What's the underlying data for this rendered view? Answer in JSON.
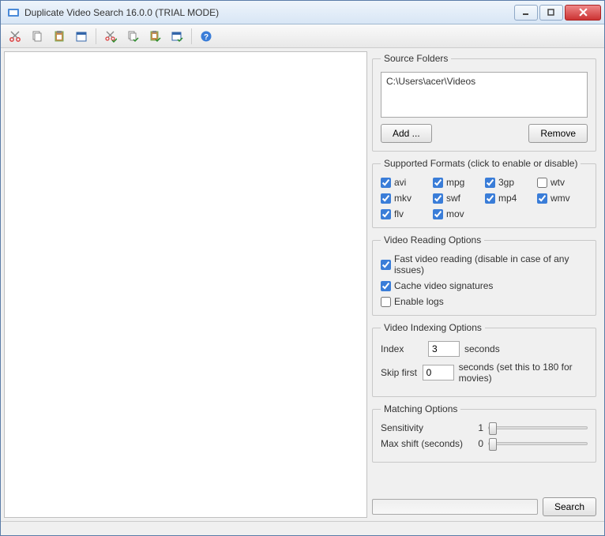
{
  "window": {
    "title": "Duplicate Video Search 16.0.0 (TRIAL MODE)"
  },
  "source_folders": {
    "legend": "Source Folders",
    "paths": [
      "C:\\Users\\acer\\Videos"
    ],
    "add_label": "Add ...",
    "remove_label": "Remove"
  },
  "formats": {
    "legend": "Supported Formats (click to enable or disable)",
    "items": [
      {
        "name": "avi",
        "checked": true
      },
      {
        "name": "mpg",
        "checked": true
      },
      {
        "name": "3gp",
        "checked": true
      },
      {
        "name": "wtv",
        "checked": false
      },
      {
        "name": "mkv",
        "checked": true
      },
      {
        "name": "swf",
        "checked": true
      },
      {
        "name": "mp4",
        "checked": true
      },
      {
        "name": "wmv",
        "checked": true
      },
      {
        "name": "flv",
        "checked": true
      },
      {
        "name": "mov",
        "checked": true
      }
    ]
  },
  "reading": {
    "legend": "Video Reading Options",
    "fast_label": "Fast video reading (disable in case of any issues)",
    "fast_checked": true,
    "cache_label": "Cache video signatures",
    "cache_checked": true,
    "logs_label": "Enable logs",
    "logs_checked": false
  },
  "indexing": {
    "legend": "Video Indexing Options",
    "index_label": "Index",
    "index_value": "3",
    "index_unit": "seconds",
    "skip_label": "Skip first",
    "skip_value": "0",
    "skip_unit": "seconds (set this to 180 for movies)"
  },
  "matching": {
    "legend": "Matching Options",
    "sensitivity_label": "Sensitivity",
    "sensitivity_value": "1",
    "maxshift_label": "Max shift (seconds)",
    "maxshift_value": "0"
  },
  "search_label": "Search"
}
